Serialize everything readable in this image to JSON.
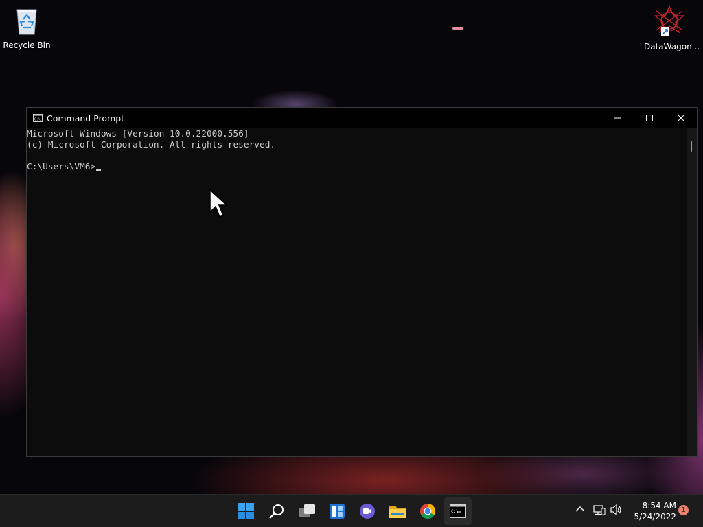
{
  "desktop": {
    "icons": [
      {
        "label": "Recycle Bin",
        "icon": "recycle-bin-icon"
      },
      {
        "label": "DataWagon...",
        "icon": "datawagon-shortcut-icon"
      }
    ]
  },
  "window": {
    "title": "Command Prompt",
    "icon": "cmd-icon",
    "controls": [
      "minimize-icon",
      "maximize-icon",
      "close-icon"
    ],
    "console_lines": [
      "Microsoft Windows [Version 10.0.22000.556]",
      "(c) Microsoft Corporation. All rights reserved."
    ],
    "prompt": "C:\\Users\\VM6>"
  },
  "taskbar": {
    "apps": [
      "start-icon",
      "search-icon",
      "task-view-icon",
      "widgets-icon",
      "chat-icon",
      "file-explorer-icon",
      "chrome-icon",
      "cmd-icon"
    ],
    "active_app": "cmd-icon",
    "tray_icons": [
      "chevron-up-icon",
      "network-icon",
      "volume-icon"
    ],
    "time": "8:54 AM",
    "date": "5/24/2022",
    "notification_count": "1"
  },
  "colors": {
    "console_bg": "#0c0c0c",
    "console_text": "#cccccc",
    "taskbar_bg": "#1c1c1c",
    "notification": "#e8826e"
  }
}
